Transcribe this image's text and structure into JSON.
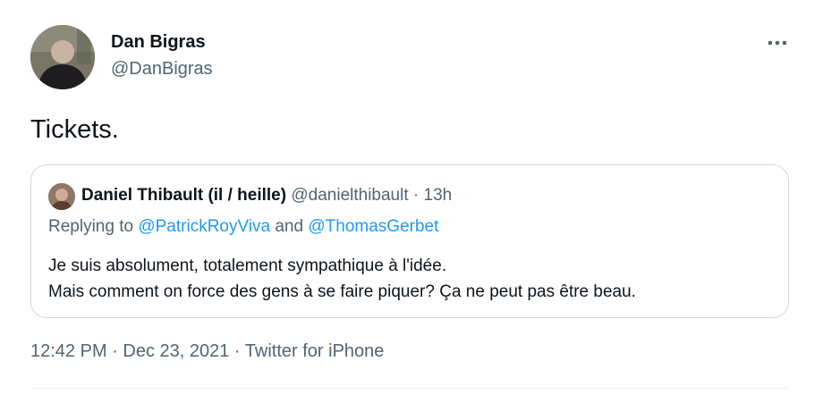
{
  "tweet": {
    "author": {
      "name": "Dan Bigras",
      "handle": "@DanBigras"
    },
    "more_icon": "more-horizontal-icon",
    "text": "Tickets.",
    "quoted": {
      "name": "Daniel Thibault (il / heille)",
      "handle": "@danielthibault",
      "separator": "·",
      "time": "13h",
      "replying_prefix": "Replying to ",
      "mention_1": "@PatrickRoyViva",
      "and_word": " and ",
      "mention_2": "@ThomasGerbet",
      "line_1": "Je suis absolument, totalement sympathique à l'idée.",
      "line_2": "Mais comment on force des gens à se faire piquer? Ça ne peut pas être beau."
    },
    "meta": {
      "time": "12:42 PM",
      "sep_1": " · ",
      "date": "Dec 23, 2021",
      "sep_2": " · ",
      "source": "Twitter for iPhone"
    }
  },
  "colors": {
    "text": "#0f1419",
    "secondary": "#536471",
    "link": "#1d9bf0",
    "border": "#cfd9de"
  }
}
